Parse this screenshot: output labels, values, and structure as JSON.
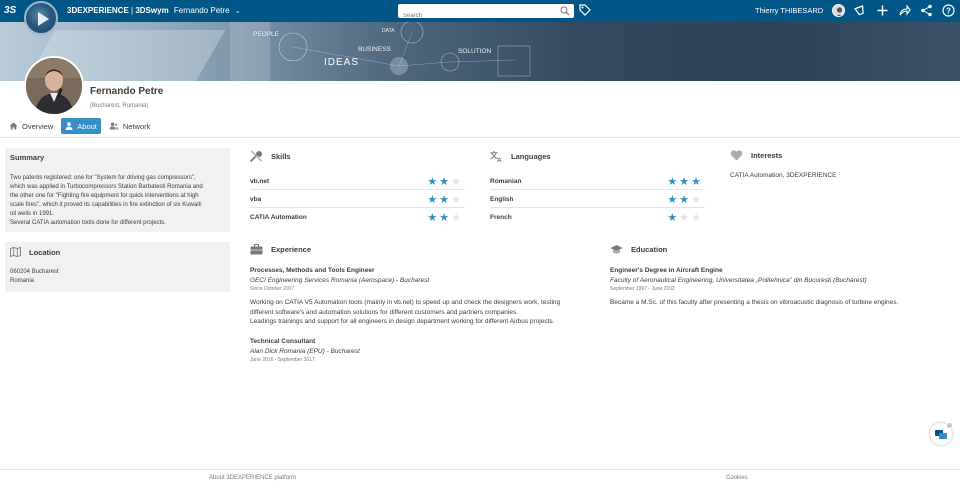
{
  "topbar": {
    "logo_text": "3S",
    "brand_bold": "3DEXPERIENCE",
    "brand_sep": " | ",
    "brand_app": "3DSwym",
    "brand_context": "Fernando Petre",
    "search_placeholder": "Search",
    "user_name": "Thierry THIBESARD",
    "background": "#005686"
  },
  "banner": {
    "words": [
      "PEOPLE",
      "DATA",
      "BUSINESS",
      "IDEAS",
      "SOLUTION"
    ]
  },
  "profile": {
    "name": "Fernando Petre",
    "location": "(Bucharest, Romania)"
  },
  "tabs": [
    {
      "label": "Overview",
      "icon": "home-icon",
      "active": false
    },
    {
      "label": "About",
      "icon": "user-icon",
      "active": true
    },
    {
      "label": "Network",
      "icon": "people-icon",
      "active": false
    }
  ],
  "summary": {
    "title": "Summary",
    "lines": [
      "Two patents registered: one for \"System for driving gas compressors\",",
      "which was applied in Turbocompressors Station Barbatesti Romania and",
      "the other one for \"Fighting fire equipment for quick interventions at high",
      "scale fires\", which it proved its capabilities in fire extinction of six Kuwaiti",
      "oil wells in 1991.",
      "Several CATIA automation tools done for different projects."
    ]
  },
  "location": {
    "title": "Location",
    "line1": "060204 Bucharest",
    "line2": "Romania"
  },
  "skills": {
    "title": "Skills",
    "items": [
      {
        "name": "vb.net",
        "rating": 2,
        "max": 3
      },
      {
        "name": "vba",
        "rating": 2,
        "max": 3
      },
      {
        "name": "CATIA Automation",
        "rating": 2,
        "max": 3
      }
    ]
  },
  "languages": {
    "title": "Languages",
    "items": [
      {
        "name": "Romanian",
        "rating": 3,
        "max": 3
      },
      {
        "name": "English",
        "rating": 2,
        "max": 3
      },
      {
        "name": "French",
        "rating": 1,
        "max": 3
      }
    ]
  },
  "interests": {
    "title": "Interests",
    "text": "CATIA Automation, 3DEXPERIENCE"
  },
  "experience": {
    "title": "Experience",
    "items": [
      {
        "title": "Processes, Methods and Tools Engineer",
        "company": "GECI Engineering Services Romania (Aerospace) - Bucharest",
        "dates": "Since October 2017",
        "description": [
          "Working on CATIA V5 Automation tools (mainly in vb.net) to speed up and check the designers work, testing",
          "different software's and automation solutions for different customers and partners companies.",
          "Leadings trainings and support for all engineers in design department working for different Airbus projects."
        ]
      },
      {
        "title": "Technical Consultant",
        "company": "Alan Dick Romania (EPU) - Bucharest",
        "dates": "June 2016 - September 2017",
        "description": []
      }
    ]
  },
  "education": {
    "title": "Education",
    "items": [
      {
        "title": "Engineer's Degree in Aircraft Engine",
        "school": "Faculty of Aeronautical Engineering, Universitatea „Politehnica” din București (Bucharest)",
        "dates": "September 1997 - June 2002",
        "description": "Became a M.Sc. of this faculty after presenting a thesis on vibroacustic diagnosis of turbine engines."
      }
    ]
  },
  "footer": {
    "about": "About 3DEXPERIENCE platform",
    "cookies": "Cookies"
  },
  "colors": {
    "accent": "#368ec4",
    "star_off": "#e2e4e3",
    "card_bg": "#f1f1f1",
    "text": "#3d3d3d",
    "muted": "#77797c"
  }
}
